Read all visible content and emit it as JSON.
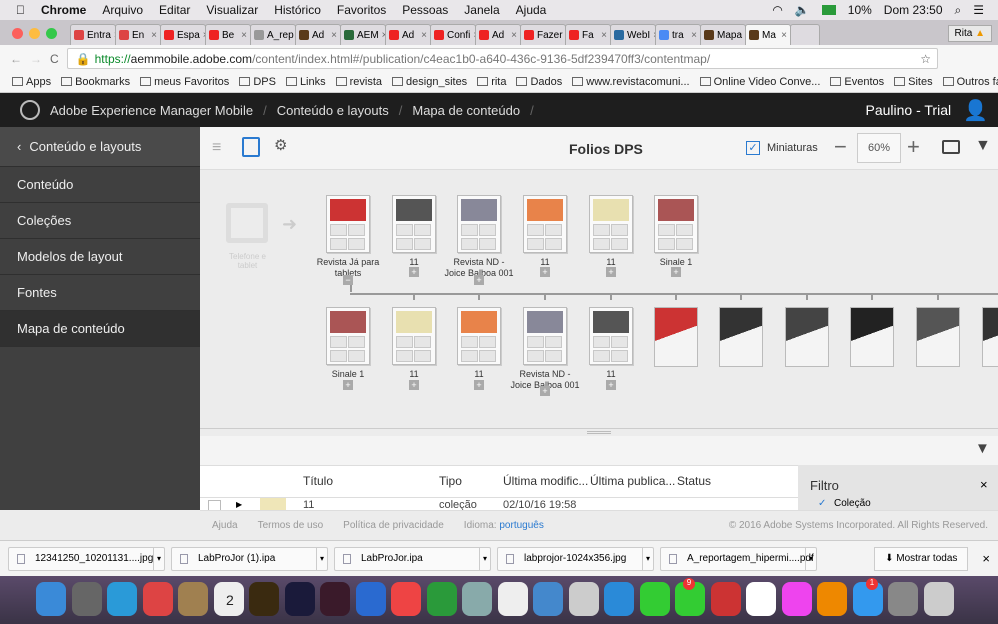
{
  "menubar": {
    "app": "Chrome",
    "items": [
      "Arquivo",
      "Editar",
      "Visualizar",
      "Histórico",
      "Favoritos",
      "Pessoas",
      "Janela",
      "Ajuda"
    ],
    "battery": "10%",
    "clock": "Dom 23:50"
  },
  "tabs": [
    {
      "label": "Entra",
      "color": "#d44"
    },
    {
      "label": "En",
      "color": "#d44"
    },
    {
      "label": "Espa",
      "color": "#e22"
    },
    {
      "label": "Be",
      "color": "#e22"
    },
    {
      "label": "A_rep",
      "color": "#999"
    },
    {
      "label": "Ad",
      "color": "#5a3a1a"
    },
    {
      "label": "AEM",
      "color": "#2a6a3a"
    },
    {
      "label": "Ad",
      "color": "#e22"
    },
    {
      "label": "Confi",
      "color": "#e22"
    },
    {
      "label": "Ad",
      "color": "#e22"
    },
    {
      "label": "Fazer",
      "color": "#e22"
    },
    {
      "label": "Fa",
      "color": "#e22"
    },
    {
      "label": "WebI",
      "color": "#2a6aa0"
    },
    {
      "label": "tra",
      "color": "#4a8af4"
    },
    {
      "label": "Mapa",
      "color": "#5a3a1a"
    },
    {
      "label": "Ma",
      "color": "#5a3a1a",
      "active": true
    }
  ],
  "profile": "Rita",
  "url": {
    "scheme": "https://",
    "host": "aemmobile.adobe.com",
    "path": "/content/index.html#/publication/c4eac1b0-a640-436c-9136-5df239470ff3/contentmap/"
  },
  "bookmarks": [
    "Apps",
    "Bookmarks",
    "meus Favoritos",
    "DPS",
    "Links",
    "revista",
    "design_sites",
    "rita",
    "Dados",
    "www.revistacomuni...",
    "Online Video Conve...",
    "Eventos",
    "Sites"
  ],
  "other_bookmarks": "Outros favoritos",
  "header": {
    "product": "Adobe Experience Manager Mobile",
    "crumbs": [
      "Conteúdo e layouts",
      "Mapa de conteúdo"
    ],
    "user": "Paulino - Trial"
  },
  "sidebar": {
    "back": "Conteúdo e layouts",
    "items": [
      "Conteúdo",
      "Coleções",
      "Modelos de layout",
      "Fontes",
      "Mapa de conteúdo"
    ],
    "selected": 4
  },
  "toolbar": {
    "title": "Folios DPS",
    "thumbnails_label": "Miniaturas",
    "thumbnails_checked": true,
    "zoom": "60%"
  },
  "map": {
    "device_label": "Telefone e tablet",
    "top_row": [
      {
        "label": "Revista Já para tablets",
        "img": "#c33",
        "expanded": true
      },
      {
        "label": "11",
        "img": "#555"
      },
      {
        "label": "Revista ND - Joice Balboa 001",
        "img": "#889"
      },
      {
        "label": "11",
        "img": "#e8834a"
      },
      {
        "label": "11",
        "img": "#e8e0b0"
      },
      {
        "label": "Sinale 1",
        "img": "#a55"
      }
    ],
    "bottom_collections": [
      {
        "label": "Sinale 1",
        "img": "#a55"
      },
      {
        "label": "11",
        "img": "#e8e0b0"
      },
      {
        "label": "11",
        "img": "#e8834a"
      },
      {
        "label": "Revista ND - Joice Balboa 001",
        "img": "#889"
      },
      {
        "label": "11",
        "img": "#555"
      }
    ],
    "bottom_articles": [
      "#c33",
      "#333",
      "#444",
      "#222",
      "#555",
      "#333"
    ]
  },
  "table": {
    "columns": [
      "Título",
      "Tipo",
      "Última modific...",
      "Última publica...",
      "Status"
    ],
    "row": {
      "title": "11",
      "type": "coleção",
      "modified": "02/10/16 19:58"
    }
  },
  "filter": {
    "title": "Filtro",
    "first_option": "Coleção"
  },
  "footer": {
    "links": [
      "Ajuda",
      "Termos de uso",
      "Política de privacidade"
    ],
    "language_label": "Idioma:",
    "language": "português",
    "copyright": "© 2016 Adobe Systems Incorporated. All Rights Reserved."
  },
  "downloads": {
    "files": [
      "12341250_10201131....jpg",
      "LabProJor (1).ipa",
      "LabProJor.ipa",
      "labprojor-1024x356.jpg",
      "A_reportagem_hipermi....pdf"
    ],
    "show_all": "Mostrar todas"
  },
  "dock": {
    "badges": [
      "9",
      "1"
    ],
    "calendar_day": "2"
  }
}
